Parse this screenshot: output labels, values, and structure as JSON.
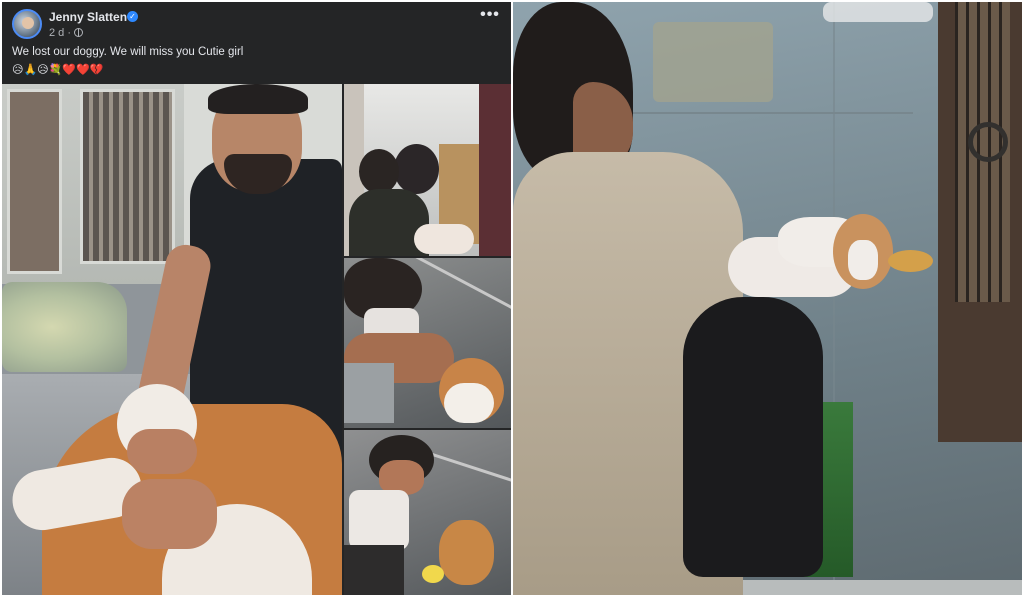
{
  "post": {
    "author": "Jenny Slatten",
    "timestamp": "2 d ·",
    "caption": "We lost our doggy. We will miss you Cutie girl",
    "emojis": "😥🙏😥💐❤️❤️💔",
    "more_label": "•••"
  },
  "icons": {
    "verified": "verified-badge-icon",
    "privacy": "globe-icon",
    "more": "more-options-icon"
  },
  "colors": {
    "panel": "#242526",
    "text": "#e4e6eb",
    "muted": "#b0b3b8",
    "accent": "#2d88ff"
  }
}
